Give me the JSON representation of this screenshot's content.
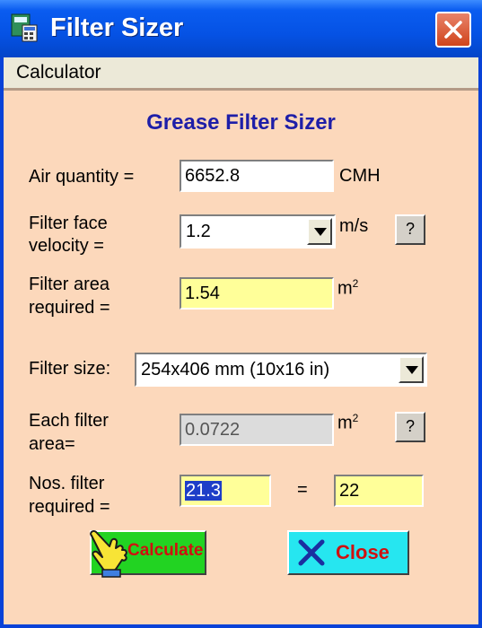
{
  "window": {
    "title": "Filter Sizer",
    "icon": "calculator-app-icon",
    "close_icon": "close-icon"
  },
  "menu": {
    "items": [
      "Calculator"
    ]
  },
  "form": {
    "heading": "Grease Filter Sizer",
    "air_quantity": {
      "label": "Air quantity =",
      "value": "6652.8",
      "unit": "CMH"
    },
    "face_velocity": {
      "label_line1": "Filter face",
      "label_line2": "velocity =",
      "value": "1.2",
      "unit": "m/s",
      "help": "?"
    },
    "filter_area": {
      "label_line1": "Filter area",
      "label_line2": "required =",
      "value": "1.54",
      "unit": "m",
      "unit_sup": "2"
    },
    "filter_size": {
      "label": "Filter size:",
      "value": "254x406 mm (10x16 in)"
    },
    "each_area": {
      "label_line1": "Each filter",
      "label_line2": "area=",
      "value": "0.0722",
      "unit": "m",
      "unit_sup": "2",
      "help": "?"
    },
    "nos_filter": {
      "label_line1": "Nos. filter",
      "label_line2": "required =",
      "value": "21.3",
      "equals": "=",
      "rounded": "22"
    }
  },
  "buttons": {
    "calculate": "Calculate",
    "close": "Close"
  },
  "colors": {
    "title_bar": "#0552e4",
    "client_bg": "#fcd8bb",
    "heading": "#1e1ea8",
    "calculate_bg": "#22d322",
    "close_bg": "#26e6f0",
    "button_text": "#d01010",
    "yellow_field": "#ffff99"
  }
}
